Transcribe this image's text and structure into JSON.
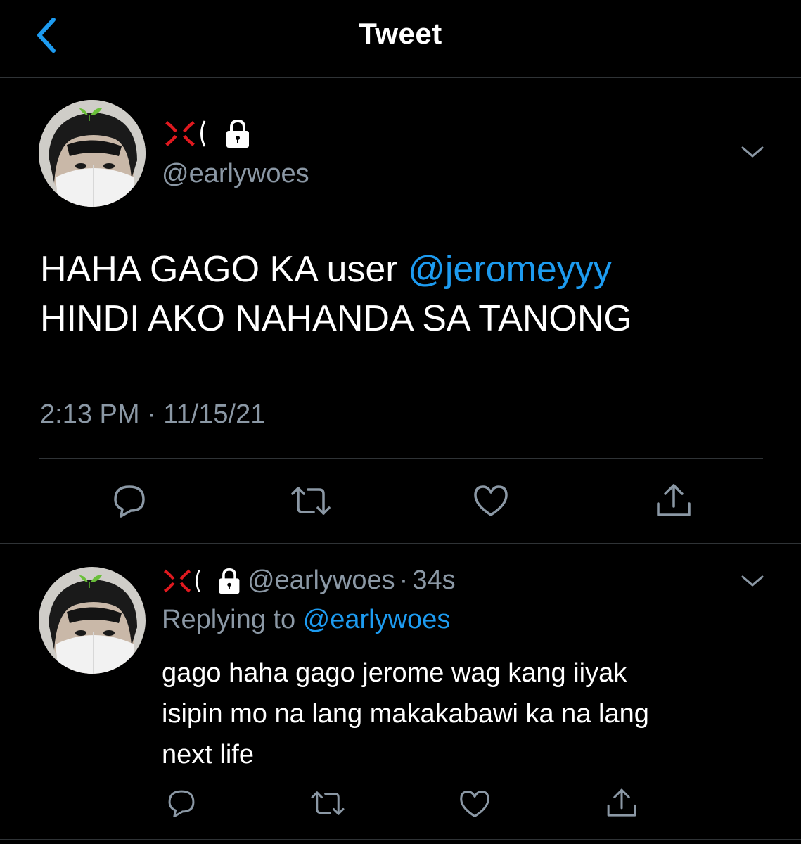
{
  "header": {
    "title": "Tweet",
    "back_icon": "chevron-left-icon"
  },
  "main_tweet": {
    "author_handle": "@earlywoes",
    "badge_icons": [
      "anger-symbol-icon",
      "lock-icon"
    ],
    "text_part1": "HAHA GAGO KA user ",
    "mention": "@jeromeyyy",
    "text_line2": "HINDI AKO NAHANDA SA TANONG",
    "timestamp": "2:13 PM · 11/15/21",
    "actions": [
      "reply-icon",
      "retweet-icon",
      "like-icon",
      "share-icon"
    ]
  },
  "reply_tweet": {
    "author_handle": "@earlywoes",
    "separator": "·",
    "time_ago": "34s",
    "replying_prefix": "Replying to ",
    "replying_to": "@earlywoes",
    "text_line1": "gago haha gago jerome wag kang iiyak",
    "text_line2": "isipin mo na lang makakabawi ka na lang",
    "text_line3": "next life",
    "actions": [
      "reply-icon",
      "retweet-icon",
      "like-icon",
      "share-icon"
    ]
  },
  "colors": {
    "background": "#000000",
    "text": "#ffffff",
    "secondary": "#8b98a5",
    "accent": "#1d9bf0",
    "divider": "#2f3336",
    "anger": "#e0191f"
  }
}
